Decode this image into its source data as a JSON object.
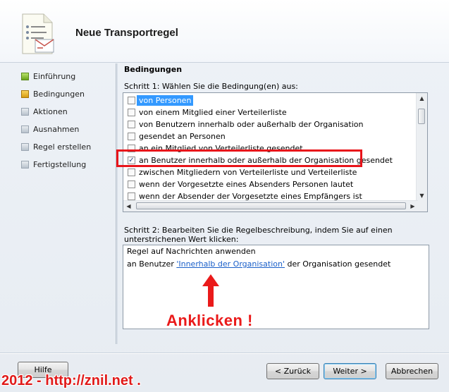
{
  "window": {
    "title": "Neue Transportregel"
  },
  "steps": [
    {
      "label": "Einführung",
      "state": "done"
    },
    {
      "label": "Bedingungen",
      "state": "active"
    },
    {
      "label": "Aktionen",
      "state": "pending"
    },
    {
      "label": "Ausnahmen",
      "state": "pending"
    },
    {
      "label": "Regel erstellen",
      "state": "pending"
    },
    {
      "label": "Fertigstellung",
      "state": "pending"
    }
  ],
  "conditions": {
    "section_title": "Bedingungen",
    "step1_label": "Schritt 1: Wählen Sie die Bedingung(en) aus:",
    "items": [
      {
        "label": "von Personen",
        "checked": false,
        "selected": true
      },
      {
        "label": "von einem Mitglied einer Verteilerliste",
        "checked": false
      },
      {
        "label": "von Benutzern innerhalb oder außerhalb der Organisation",
        "checked": false
      },
      {
        "label": "gesendet an Personen",
        "checked": false
      },
      {
        "label": "an ein Mitglied von Verteilerliste gesendet",
        "checked": false
      },
      {
        "label": "an Benutzer innerhalb oder außerhalb der Organisation gesendet",
        "checked": true
      },
      {
        "label": "zwischen Mitgliedern von Verteilerliste und Verteilerliste",
        "checked": false
      },
      {
        "label": "wenn der Vorgesetzte eines Absenders Personen lautet",
        "checked": false
      },
      {
        "label": "wenn der Absender der Vorgesetzte eines Empfängers ist",
        "checked": false
      }
    ],
    "step2_label": "Schritt 2: Bearbeiten Sie die Regelbeschreibung, indem Sie auf einen unterstrichenen Wert klicken:",
    "description": {
      "line1": "Regel auf Nachrichten anwenden",
      "line2_prefix": "an Benutzer ",
      "line2_link": "'Innerhalb der Organisation'",
      "line2_suffix": " der Organisation gesendet"
    }
  },
  "annotation": {
    "text": "Anklicken !",
    "color": "#ea1a1a"
  },
  "buttons": {
    "help": "Hilfe",
    "back": "< Zurück",
    "next": "Weiter >",
    "cancel": "Abbrechen"
  },
  "watermark": "2012 - http://znil.net ."
}
